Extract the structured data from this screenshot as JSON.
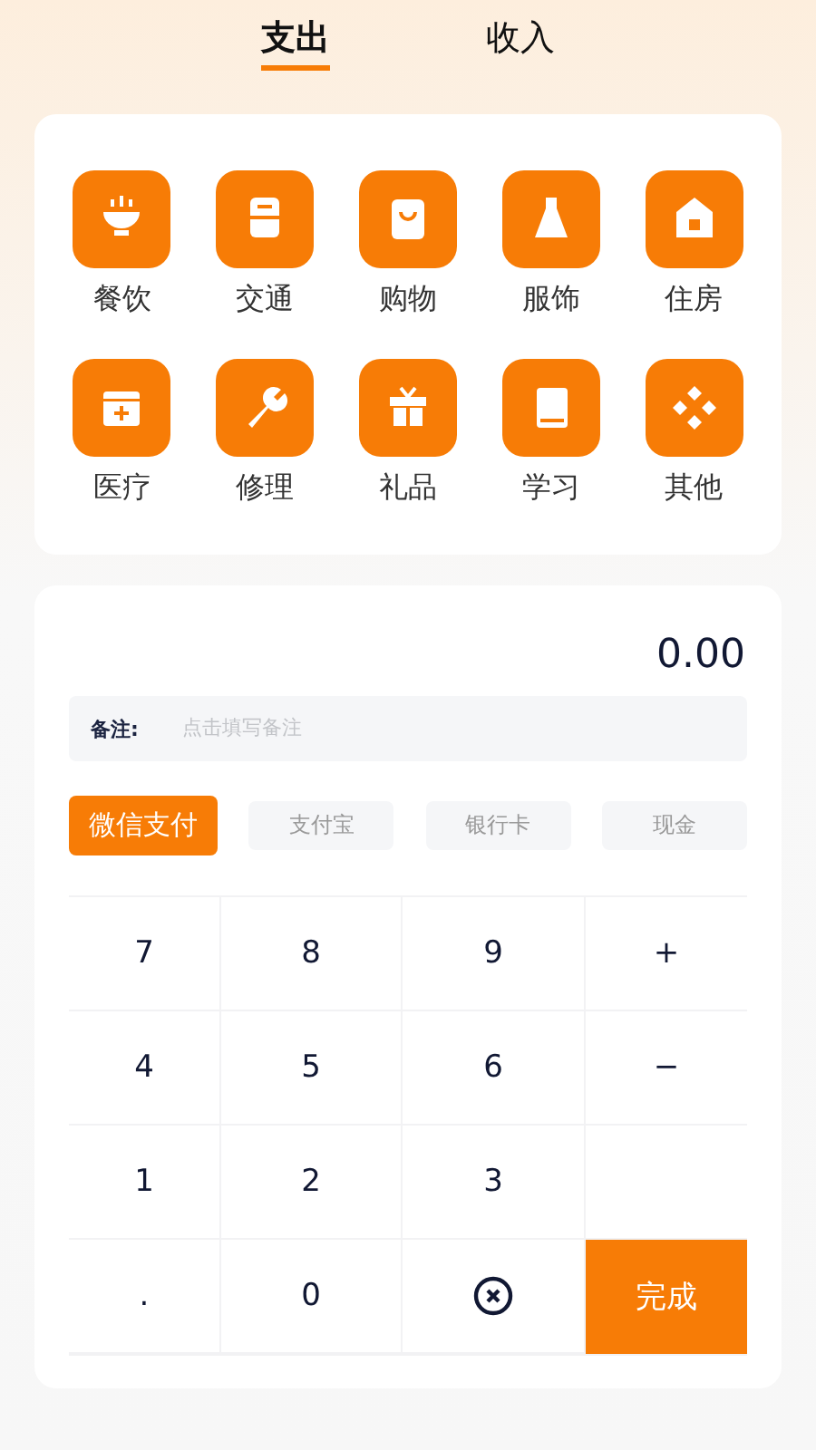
{
  "tabs": [
    {
      "label": "支出",
      "selected": true
    },
    {
      "label": "收入",
      "selected": false
    }
  ],
  "categories": [
    {
      "label": "餐饮"
    },
    {
      "label": "交通"
    },
    {
      "label": "购物"
    },
    {
      "label": "服饰"
    },
    {
      "label": "住房"
    },
    {
      "label": "医疗"
    },
    {
      "label": "修理"
    },
    {
      "label": "礼品"
    },
    {
      "label": "学习"
    },
    {
      "label": "其他"
    }
  ],
  "amount": "0.00",
  "note": {
    "label": "备注:",
    "placeholder": "点击填写备注"
  },
  "payments": [
    {
      "label": "微信支付",
      "selected": true
    },
    {
      "label": "支付宝",
      "selected": false
    },
    {
      "label": "银行卡",
      "selected": false
    },
    {
      "label": "现金",
      "selected": false
    }
  ],
  "keys": [
    {
      "kind": "key",
      "label": "7"
    },
    {
      "kind": "key",
      "label": "8"
    },
    {
      "kind": "key",
      "label": "9"
    },
    {
      "kind": "key",
      "label": "+"
    },
    {
      "kind": "key",
      "label": "4"
    },
    {
      "kind": "key",
      "label": "5"
    },
    {
      "kind": "key",
      "label": "6"
    },
    {
      "kind": "key",
      "label": "−"
    },
    {
      "kind": "key",
      "label": "1"
    },
    {
      "kind": "key",
      "label": "2"
    },
    {
      "kind": "key",
      "label": "3"
    },
    {
      "kind": "empty"
    },
    {
      "kind": "key",
      "label": "."
    },
    {
      "kind": "key",
      "label": "0"
    },
    {
      "kind": "backspace"
    },
    {
      "kind": "done",
      "label": "完成"
    }
  ]
}
